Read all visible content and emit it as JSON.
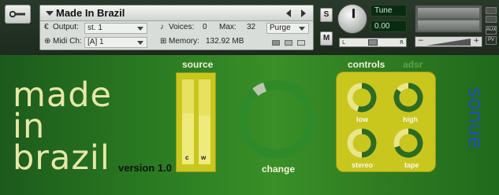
{
  "instrument": {
    "name": "Made In Brazil",
    "output_label": "Output:",
    "output_value": "st. 1",
    "voices_label": "Voices:",
    "voices_value": "0",
    "max_label": "Max:",
    "max_value": "32",
    "purge_label": "Purge",
    "midi_label": "Midi Ch:",
    "midi_value": "[A] 1",
    "memory_label": "Memory:",
    "memory_value": "132.92 MB"
  },
  "side_buttons": {
    "solo": "S",
    "mute": "M"
  },
  "tune": {
    "label": "Tune",
    "value": "0.00"
  },
  "pan": {
    "left": "L",
    "right": "R"
  },
  "output_panel": {
    "aux": "AUX",
    "pv": "PV"
  },
  "title": {
    "line1": "made",
    "line2": "in",
    "line3": "brazil",
    "version": "version 1.0"
  },
  "source": {
    "label": "source",
    "sliders": [
      {
        "label": "c",
        "level": 0.6
      },
      {
        "label": "w",
        "level": 0.57
      }
    ]
  },
  "change": {
    "label": "change",
    "value": 0.05
  },
  "controls": {
    "label": "controls",
    "tab_adsr": "adsr",
    "knobs": [
      {
        "label": "low",
        "value": 0.55
      },
      {
        "label": "high",
        "value": 0.85
      },
      {
        "label": "stereo",
        "value": 0.5
      },
      {
        "label": "tape",
        "value": 0.7
      }
    ]
  },
  "brand": {
    "name": "sonue"
  },
  "colors": {
    "accent_yellow": "#c9c61e",
    "knob_green": "#2d6b22",
    "brand_blue": "#1f4fb8",
    "title_cream": "#e8e6a8"
  }
}
